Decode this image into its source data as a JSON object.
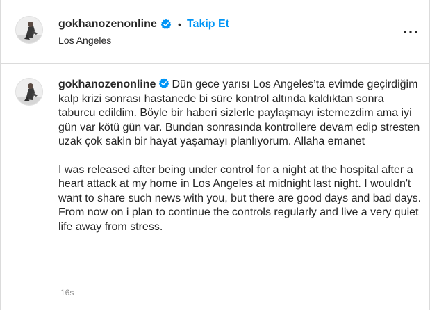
{
  "post": {
    "username": "gokhanozenonline",
    "verified": true,
    "separator": "•",
    "follow_label": "Takip Et",
    "location": "Los Angeles"
  },
  "caption": {
    "username": "gokhanozenonline",
    "text_tr": "Dün gece yarısı Los Angeles’ta evimde geçirdiğim kalp krizi sonrası hastanede bi süre kontrol altında kaldıktan sonra taburcu edildim. Böyle bir haberi sizlerle paylaşmayı istemezdim ama iyi gün var kötü gün var. Bundan sonrasında kontrollere devam edip stresten uzak çok sakin bir hayat yaşamayı planlıyorum. Allaha emanet",
    "text_en": "I was released after being under control for a night at the hospital after a heart attack at my home in Los Angeles at midnight last night. I wouldn't want to share such news with you, but there are good days and bad days. From now on i plan to continue the controls regularly and live a very quiet life away from stress.",
    "timestamp": "16s"
  },
  "colors": {
    "text": "#262626",
    "link": "#0095f6",
    "muted": "#8e8e8e",
    "border": "#dbdbdb",
    "verified": "#0095f6"
  },
  "icons": {
    "verified": "verified-badge-icon",
    "more": "more-options-icon",
    "avatar": "profile-photo"
  }
}
